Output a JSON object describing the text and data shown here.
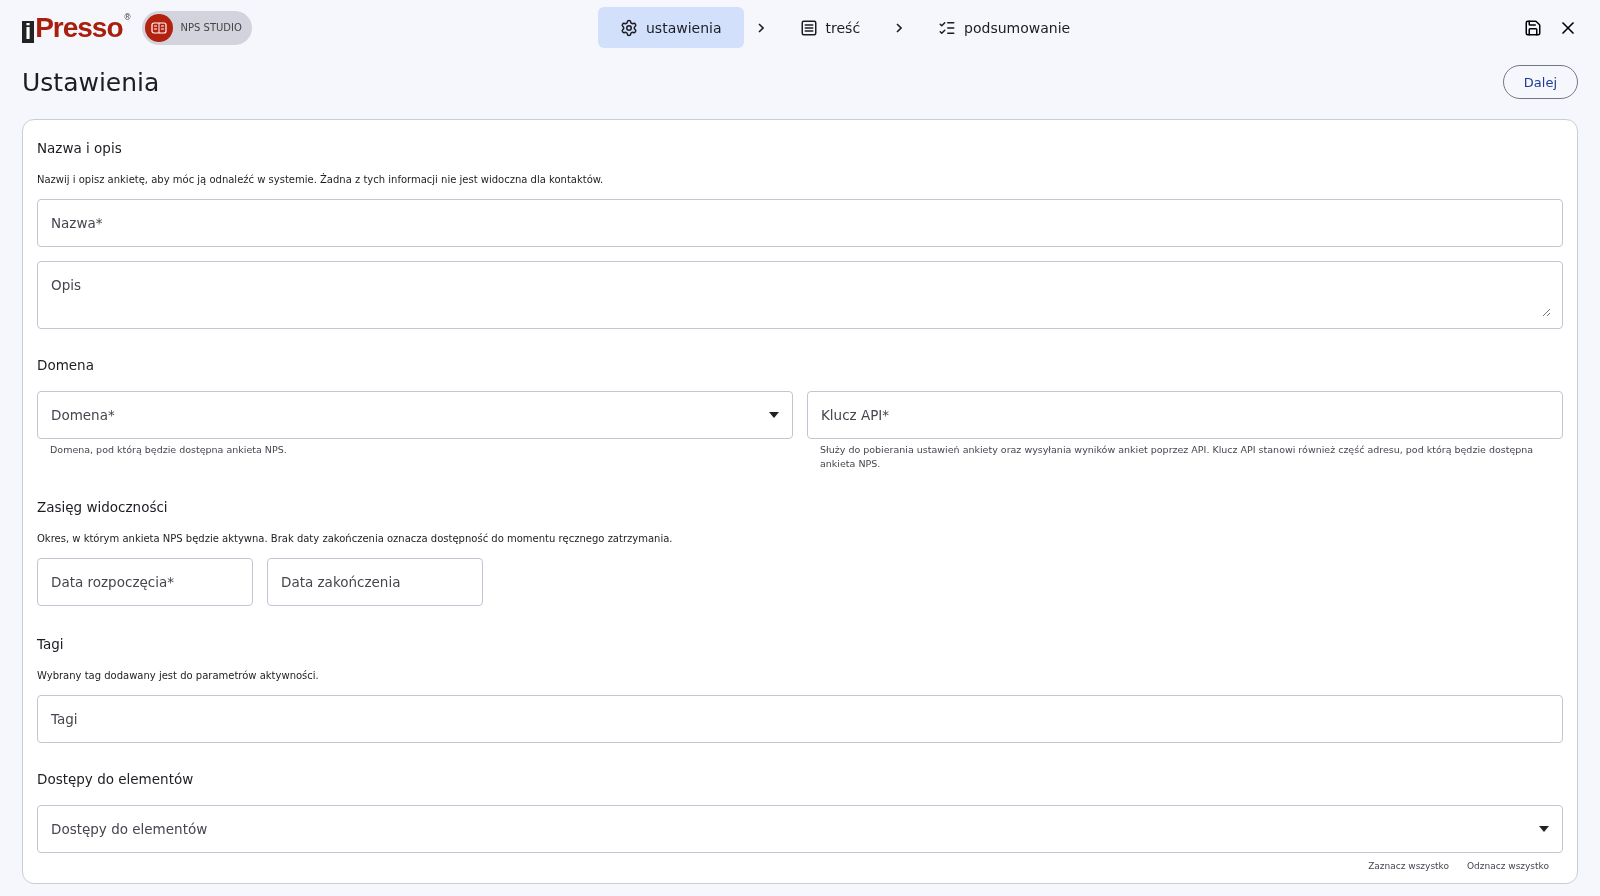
{
  "logo": {
    "mark": "i",
    "name": "Presso",
    "registered": "®"
  },
  "badge": {
    "label": "NPS STUDIO"
  },
  "steps": [
    {
      "kind": "settings",
      "label": "ustawienia",
      "selected": true
    },
    {
      "kind": "content",
      "label": "treść",
      "selected": false
    },
    {
      "kind": "summary",
      "label": "podsumowanie",
      "selected": false
    }
  ],
  "page_title": "Ustawienia",
  "next_button": "Dalej",
  "sections": [
    {
      "title": "Nazwa i opis",
      "description": "Nazwij i opisz ankietę, aby móc ją odnaleźć w systemie. Żadna z tych informacji nie jest widoczna dla kontaktów.",
      "kind": "stack",
      "fields": [
        {
          "kind": "text",
          "placeholder": "Nazwa*"
        },
        {
          "kind": "textarea",
          "placeholder": "Opis"
        }
      ]
    },
    {
      "title": "Domena",
      "kind": "columns",
      "fields": [
        {
          "kind": "select",
          "placeholder": "Domena*",
          "helper": "Domena, pod którą będzie dostępna ankieta NPS."
        },
        {
          "kind": "text",
          "placeholder": "Klucz API*",
          "helper": "Służy do pobierania ustawień ankiety oraz wysyłania wyników ankiet poprzez API. Klucz API stanowi również część adresu, pod którą będzie dostępna ankieta NPS."
        }
      ]
    },
    {
      "title": "Zasięg widoczności",
      "description": "Okres, w którym ankieta NPS będzie aktywna. Brak daty zakończenia oznacza dostępność do momentu ręcznego zatrzymania.",
      "kind": "inline",
      "fields": [
        {
          "kind": "text",
          "placeholder": "Data rozpoczęcia*"
        },
        {
          "kind": "text",
          "placeholder": "Data zakończenia"
        }
      ]
    },
    {
      "title": "Tagi",
      "description": "Wybrany tag dodawany jest do parametrów aktywności.",
      "kind": "stack",
      "fields": [
        {
          "kind": "text",
          "placeholder": "Tagi"
        }
      ]
    },
    {
      "title": "Dostępy do elementów",
      "kind": "stack",
      "fields": [
        {
          "kind": "select",
          "placeholder": "Dostępy do elementów"
        }
      ],
      "links": [
        "Zaznacz wszystko",
        "Odznacz wszystko"
      ]
    }
  ]
}
